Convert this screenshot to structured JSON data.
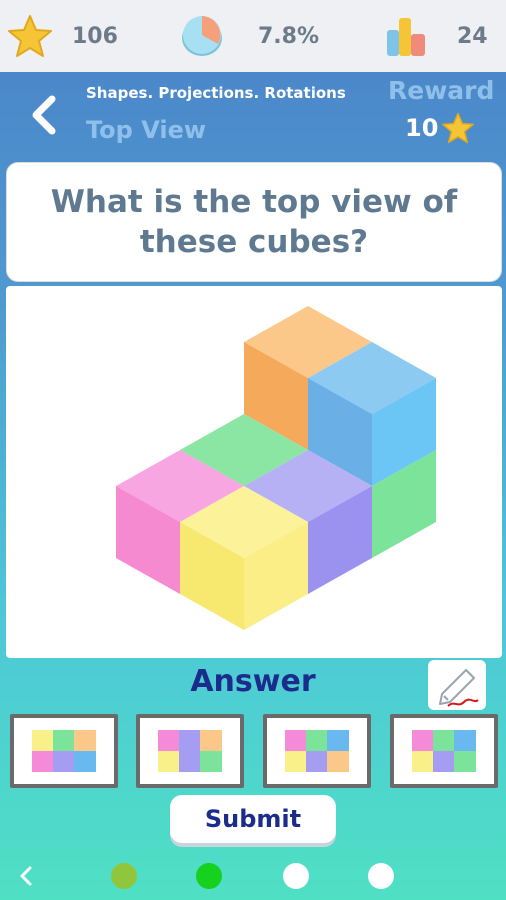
{
  "stats": {
    "stars": "106",
    "percent": "7.8%",
    "level": "24"
  },
  "header": {
    "back_icon": "chevron-left-icon",
    "breadcrumb": "Shapes. Projections. Rotations",
    "title": "Top View",
    "reward_label": "Reward",
    "reward_amount": "10"
  },
  "question": {
    "text": "What is the top view of these cubes?"
  },
  "answer": {
    "label": "Answer",
    "options": [
      "option-1",
      "option-2",
      "option-3",
      "option-4"
    ]
  },
  "submit_label": "Submit",
  "progress": {
    "dots": [
      "olive",
      "green",
      "white",
      "white"
    ]
  },
  "colors": {
    "orange": "#f5a95b",
    "blue": "#6ab8f0",
    "green": "#7be39a",
    "pink": "#f58ad8",
    "purple": "#a49df2",
    "yellow": "#faf08a",
    "star": "#f5c535",
    "dot_olive": "#8fc63b",
    "dot_green": "#16d11e",
    "navy": "#1c2c8c"
  }
}
